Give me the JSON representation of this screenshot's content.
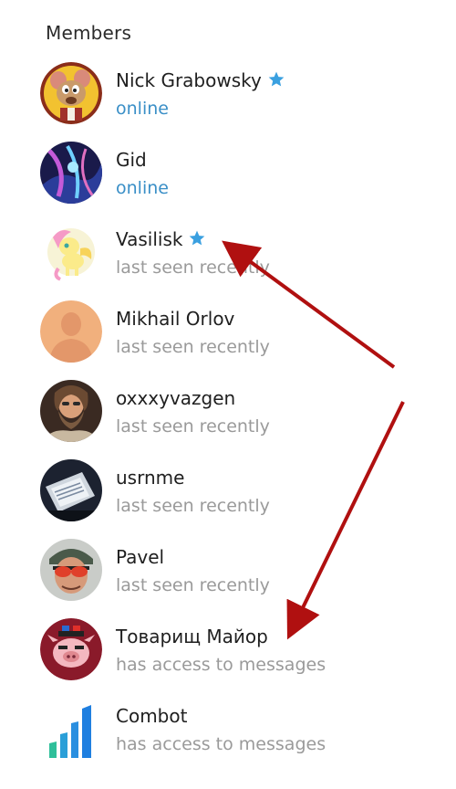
{
  "section": {
    "title": "Members"
  },
  "members": [
    {
      "name": "Nick Grabowsky",
      "status": "online",
      "starred": true,
      "avatar_icon": "rat-cartoon-avatar"
    },
    {
      "name": "Gid",
      "status": "online",
      "starred": false,
      "avatar_icon": "abstract-blue-avatar"
    },
    {
      "name": "Vasilisk",
      "status": "last seen recently",
      "starred": true,
      "avatar_icon": "pony-avatar"
    },
    {
      "name": "Mikhail Orlov",
      "status": "last seen recently",
      "starred": false,
      "avatar_icon": "default-person-avatar"
    },
    {
      "name": "oxxxyvazgen",
      "status": "last seen recently",
      "starred": false,
      "avatar_icon": "bearded-man-avatar"
    },
    {
      "name": "usrnme",
      "status": "last seen recently",
      "starred": false,
      "avatar_icon": "laptop-avatar"
    },
    {
      "name": "Pavel",
      "status": "last seen recently",
      "starred": false,
      "avatar_icon": "sunglasses-man-avatar"
    },
    {
      "name": "Товарищ Майор",
      "status": "has access to messages",
      "starred": false,
      "avatar_icon": "pig-police-avatar"
    },
    {
      "name": "Combot",
      "status": "has access to messages",
      "starred": false,
      "avatar_icon": "bar-chart-logo"
    }
  ],
  "colors": {
    "online": "#3a8fc7",
    "offline": "#9a9a9a",
    "star": "#3aa0e0",
    "arrow": "#b01010"
  }
}
